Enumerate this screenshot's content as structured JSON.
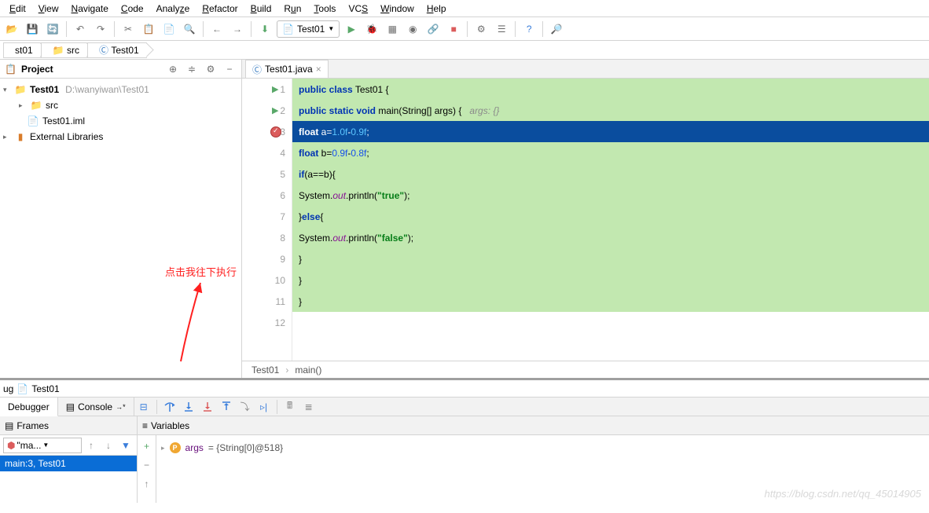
{
  "menu": {
    "items": [
      "Edit",
      "View",
      "Navigate",
      "Code",
      "Analyze",
      "Refactor",
      "Build",
      "Run",
      "Tools",
      "VCS",
      "Window",
      "Help"
    ]
  },
  "runconfig": {
    "name": "Test01"
  },
  "crumbs": {
    "c1": "st01",
    "c2": "src",
    "c3": "Test01"
  },
  "project": {
    "title": "Project",
    "root": {
      "name": "Test01",
      "path": "D:\\wanyiwan\\Test01"
    },
    "items": {
      "src": "src",
      "iml": "Test01.iml",
      "ext": "External Libraries"
    }
  },
  "editor": {
    "tab": "Test01.java",
    "lines": {
      "l1": {
        "n": "1"
      },
      "l2": {
        "n": "2"
      },
      "l3": {
        "n": "3"
      },
      "l4": {
        "n": "4"
      },
      "l5": {
        "n": "5"
      },
      "l6": {
        "n": "6"
      },
      "l7": {
        "n": "7"
      },
      "l8": {
        "n": "8"
      },
      "l9": {
        "n": "9"
      },
      "l10": {
        "n": "10"
      },
      "l11": {
        "n": "11"
      },
      "l12": {
        "n": "12"
      }
    },
    "code": {
      "c1_kw1": "public class",
      "c1_cls": " Test01 {",
      "c2_kw1": "public static void",
      "c2_m": " main(String[] args) {   ",
      "c2_cmt": "args: {}",
      "c3_kw": "float",
      "c3_rest": " a=",
      "c3_n1": "1.0f",
      "c3_m": "-",
      "c3_n2": "0.9f",
      "c3_e": ";",
      "c4_kw": "float",
      "c4_rest": " b=",
      "c4_n1": "0.9f",
      "c4_m": "-",
      "c4_n2": "0.8f",
      "c4_e": ";",
      "c5_kw": "if",
      "c5_rest": "(a==b){",
      "c6_a": "System.",
      "c6_out": "out",
      "c6_b": ".println(",
      "c6_s": "\"true\"",
      "c6_c": ");",
      "c7_a": "}",
      "c7_kw": "else",
      "c7_b": "{",
      "c8_a": "System.",
      "c8_out": "out",
      "c8_b": ".println(",
      "c8_s": "\"false\"",
      "c8_c": ");",
      "c9": "}",
      "c10": "}",
      "c11": "}"
    },
    "crumb1": "Test01",
    "crumb2": "main()"
  },
  "annotation": {
    "text": "点击我往下执行"
  },
  "debug": {
    "bc1": "ug",
    "bc2": "Test01",
    "tab_debugger": "Debugger",
    "tab_console": "Console",
    "frames_title": "Frames",
    "vars_title": "Variables",
    "thread": "\"ma...",
    "frame": "main:3, Test01",
    "var_name": "args",
    "var_val": " = {String[0]@518}"
  },
  "watermark": "https://blog.csdn.net/qq_45014905"
}
